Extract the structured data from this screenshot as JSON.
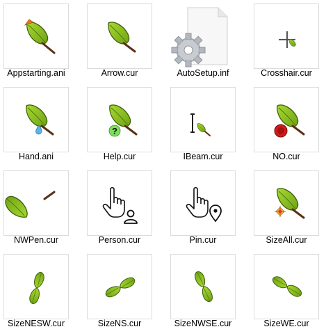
{
  "files": [
    {
      "name": "Appstarting.ani",
      "icon": "leaf-cursor-busy-icon"
    },
    {
      "name": "Arrow.cur",
      "icon": "leaf-cursor-icon"
    },
    {
      "name": "AutoSetup.inf",
      "icon": "setup-file-gear-icon"
    },
    {
      "name": "Crosshair.cur",
      "icon": "crosshair-leaf-icon"
    },
    {
      "name": "Hand.ani",
      "icon": "leaf-droplet-icon"
    },
    {
      "name": "Help.cur",
      "icon": "leaf-question-icon"
    },
    {
      "name": "IBeam.cur",
      "icon": "ibeam-leaf-icon"
    },
    {
      "name": "NO.cur",
      "icon": "leaf-no-icon"
    },
    {
      "name": "NWPen.cur",
      "icon": "leaf-pen-icon"
    },
    {
      "name": "Person.cur",
      "icon": "hand-person-icon"
    },
    {
      "name": "Pin.cur",
      "icon": "hand-pin-icon"
    },
    {
      "name": "SizeAll.cur",
      "icon": "leaf-move-icon"
    },
    {
      "name": "SizeNESW.cur",
      "icon": "double-leaf-nesw-icon"
    },
    {
      "name": "SizeNS.cur",
      "icon": "double-leaf-ns-icon"
    },
    {
      "name": "SizeNWSE.cur",
      "icon": "double-leaf-nwse-icon"
    },
    {
      "name": "SizeWE.cur",
      "icon": "double-leaf-we-icon"
    }
  ],
  "colors": {
    "leaf_fill": "#8fc21f",
    "leaf_outline": "#3f5f0a",
    "stem": "#5a2f14",
    "thumb_border": "#dcdcdc"
  }
}
